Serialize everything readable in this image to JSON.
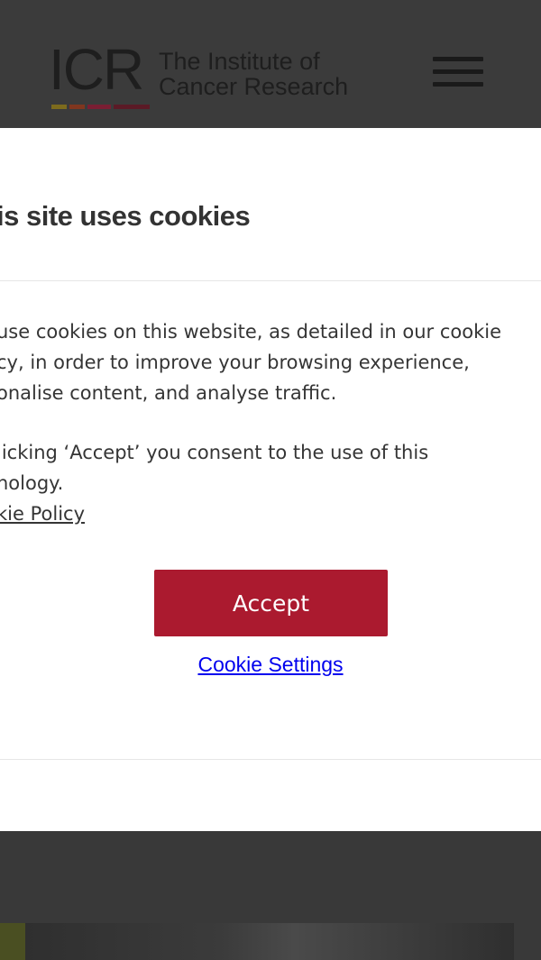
{
  "header": {
    "logo_mark": "ICR",
    "logo_line1": "The Institute of",
    "logo_line2": "Cancer Research",
    "logo_bar_colors": [
      "#7d6b1d",
      "#80361f",
      "#7a1e33",
      "#5b1a26"
    ],
    "menu_icon": "hamburger-menu-icon"
  },
  "cookie_modal": {
    "title": "is site uses cookies",
    "body_lines": [
      "use cookies on this website, as detailed in our cookie",
      "cy, in order to improve your browsing experience,",
      "onalise content, and analyse traffic."
    ],
    "consent_lines": [
      "licking ‘Accept’ you consent to the use of this",
      "nology."
    ],
    "policy_link": "kie Policy",
    "accept_label": "Accept",
    "settings_link": "Cookie Settings",
    "accent_color": "#ab1a2f"
  }
}
